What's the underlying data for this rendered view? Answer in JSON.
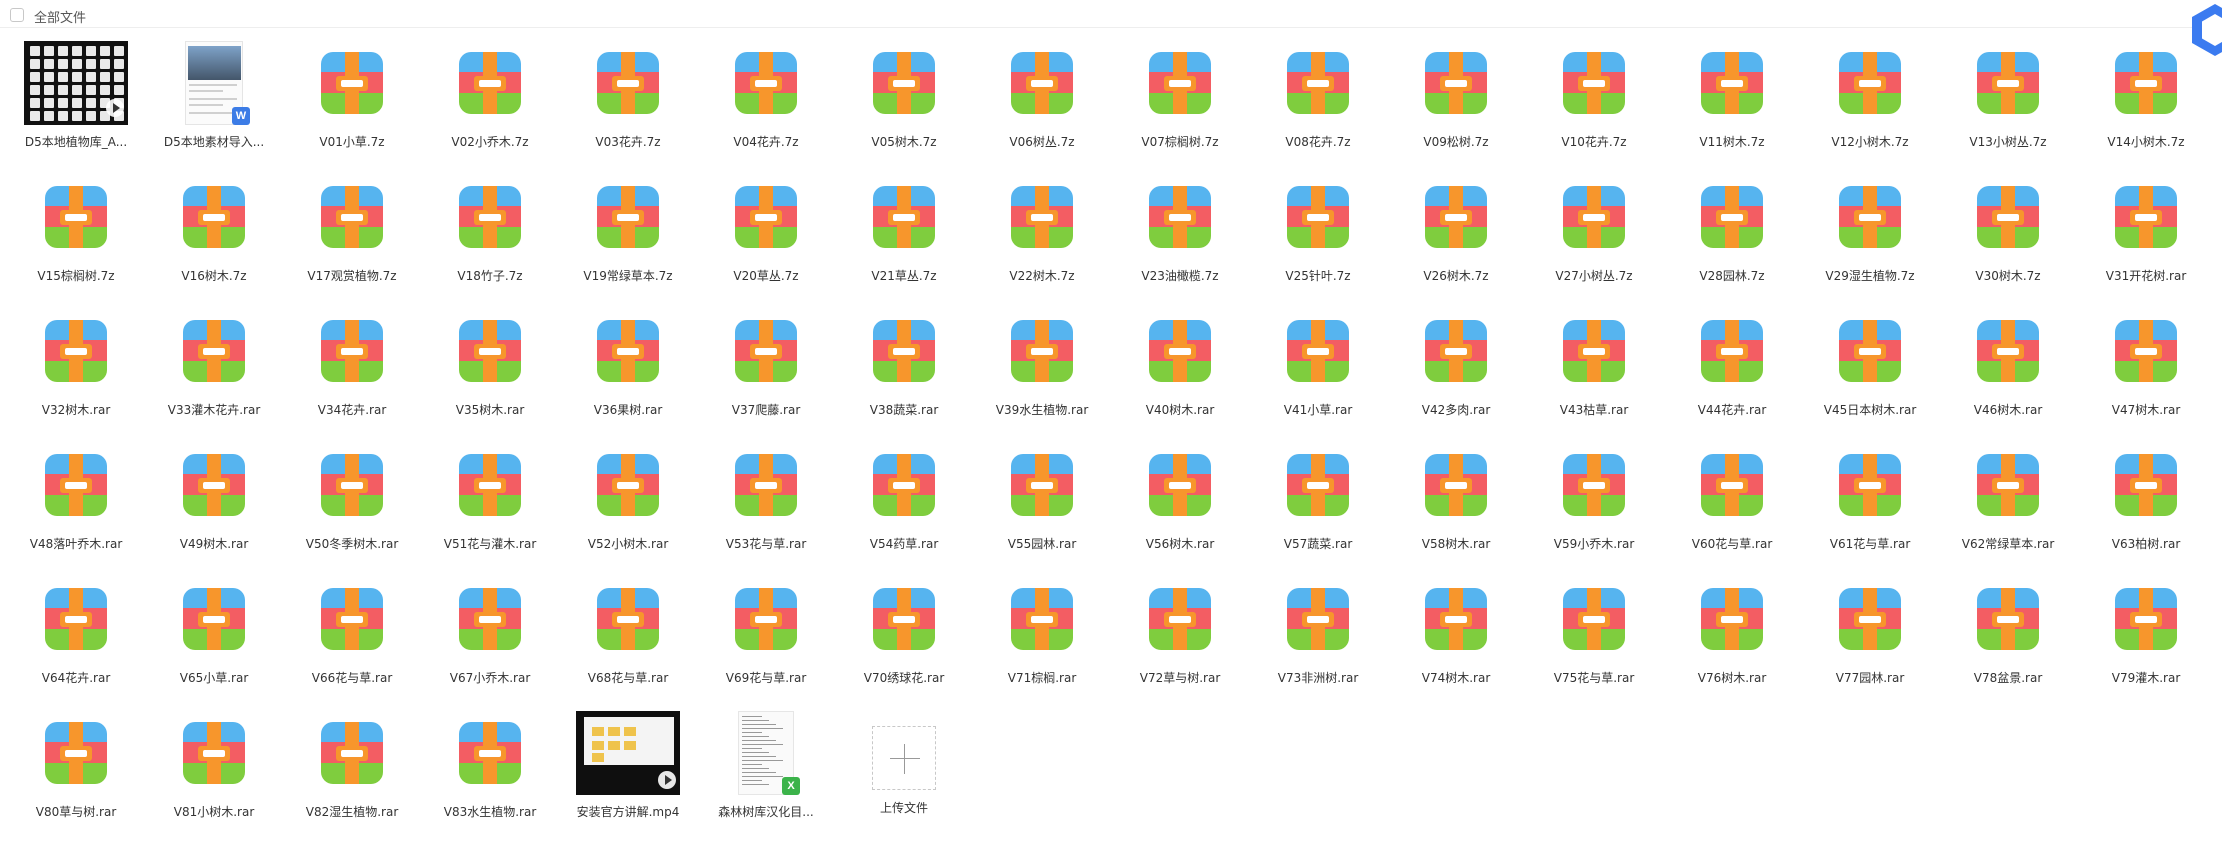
{
  "header": {
    "title": "全部文件"
  },
  "colors": {
    "archive_top": "#56b4ef",
    "archive_mid": "#f35d63",
    "archive_bottom": "#7fcd3e",
    "archive_strap": "#f7962c",
    "corner_badge": "#3b7bf0"
  },
  "files": [
    {
      "name": "D5本地植物库_A...",
      "kind": "image-grid"
    },
    {
      "name": "D5本地素材导入...",
      "kind": "word-doc"
    },
    {
      "name": "V01小草.7z",
      "kind": "archive"
    },
    {
      "name": "V02小乔木.7z",
      "kind": "archive"
    },
    {
      "name": "V03花卉.7z",
      "kind": "archive"
    },
    {
      "name": "V04花卉.7z",
      "kind": "archive"
    },
    {
      "name": "V05树木.7z",
      "kind": "archive"
    },
    {
      "name": "V06树丛.7z",
      "kind": "archive"
    },
    {
      "name": "V07棕榈树.7z",
      "kind": "archive"
    },
    {
      "name": "V08花卉.7z",
      "kind": "archive"
    },
    {
      "name": "V09松树.7z",
      "kind": "archive"
    },
    {
      "name": "V10花卉.7z",
      "kind": "archive"
    },
    {
      "name": "V11树木.7z",
      "kind": "archive"
    },
    {
      "name": "V12小树木.7z",
      "kind": "archive"
    },
    {
      "name": "V13小树丛.7z",
      "kind": "archive"
    },
    {
      "name": "V14小树木.7z",
      "kind": "archive"
    },
    {
      "name": "V15棕榈树.7z",
      "kind": "archive"
    },
    {
      "name": "V16树木.7z",
      "kind": "archive"
    },
    {
      "name": "V17观赏植物.7z",
      "kind": "archive"
    },
    {
      "name": "V18竹子.7z",
      "kind": "archive"
    },
    {
      "name": "V19常绿草本.7z",
      "kind": "archive"
    },
    {
      "name": "V20草丛.7z",
      "kind": "archive"
    },
    {
      "name": "V21草丛.7z",
      "kind": "archive"
    },
    {
      "name": "V22树木.7z",
      "kind": "archive"
    },
    {
      "name": "V23油橄榄.7z",
      "kind": "archive"
    },
    {
      "name": "V25针叶.7z",
      "kind": "archive"
    },
    {
      "name": "V26树木.7z",
      "kind": "archive"
    },
    {
      "name": "V27小树丛.7z",
      "kind": "archive"
    },
    {
      "name": "V28园林.7z",
      "kind": "archive"
    },
    {
      "name": "V29湿生植物.7z",
      "kind": "archive"
    },
    {
      "name": "V30树木.7z",
      "kind": "archive"
    },
    {
      "name": "V31开花树.rar",
      "kind": "archive"
    },
    {
      "name": "V32树木.rar",
      "kind": "archive"
    },
    {
      "name": "V33灌木花卉.rar",
      "kind": "archive"
    },
    {
      "name": "V34花卉.rar",
      "kind": "archive"
    },
    {
      "name": "V35树木.rar",
      "kind": "archive"
    },
    {
      "name": "V36果树.rar",
      "kind": "archive"
    },
    {
      "name": "V37爬藤.rar",
      "kind": "archive"
    },
    {
      "name": "V38蔬菜.rar",
      "kind": "archive"
    },
    {
      "name": "V39水生植物.rar",
      "kind": "archive"
    },
    {
      "name": "V40树木.rar",
      "kind": "archive"
    },
    {
      "name": "V41小草.rar",
      "kind": "archive"
    },
    {
      "name": "V42多肉.rar",
      "kind": "archive"
    },
    {
      "name": "V43枯草.rar",
      "kind": "archive"
    },
    {
      "name": "V44花卉.rar",
      "kind": "archive"
    },
    {
      "name": "V45日本树木.rar",
      "kind": "archive"
    },
    {
      "name": "V46树木.rar",
      "kind": "archive"
    },
    {
      "name": "V47树木.rar",
      "kind": "archive"
    },
    {
      "name": "V48落叶乔木.rar",
      "kind": "archive"
    },
    {
      "name": "V49树木.rar",
      "kind": "archive"
    },
    {
      "name": "V50冬季树木.rar",
      "kind": "archive"
    },
    {
      "name": "V51花与灌木.rar",
      "kind": "archive"
    },
    {
      "name": "V52小树木.rar",
      "kind": "archive"
    },
    {
      "name": "V53花与草.rar",
      "kind": "archive"
    },
    {
      "name": "V54药草.rar",
      "kind": "archive"
    },
    {
      "name": "V55园林.rar",
      "kind": "archive"
    },
    {
      "name": "V56树木.rar",
      "kind": "archive"
    },
    {
      "name": "V57蔬菜.rar",
      "kind": "archive"
    },
    {
      "name": "V58树木.rar",
      "kind": "archive"
    },
    {
      "name": "V59小乔木.rar",
      "kind": "archive"
    },
    {
      "name": "V60花与草.rar",
      "kind": "archive"
    },
    {
      "name": "V61花与草.rar",
      "kind": "archive"
    },
    {
      "name": "V62常绿草本.rar",
      "kind": "archive"
    },
    {
      "name": "V63柏树.rar",
      "kind": "archive"
    },
    {
      "name": "V64花卉.rar",
      "kind": "archive"
    },
    {
      "name": "V65小草.rar",
      "kind": "archive"
    },
    {
      "name": "V66花与草.rar",
      "kind": "archive"
    },
    {
      "name": "V67小乔木.rar",
      "kind": "archive"
    },
    {
      "name": "V68花与草.rar",
      "kind": "archive"
    },
    {
      "name": "V69花与草.rar",
      "kind": "archive"
    },
    {
      "name": "V70绣球花.rar",
      "kind": "archive"
    },
    {
      "name": "V71棕榈.rar",
      "kind": "archive"
    },
    {
      "name": "V72草与树.rar",
      "kind": "archive"
    },
    {
      "name": "V73非洲树.rar",
      "kind": "archive"
    },
    {
      "name": "V74树木.rar",
      "kind": "archive"
    },
    {
      "name": "V75花与草.rar",
      "kind": "archive"
    },
    {
      "name": "V76树木.rar",
      "kind": "archive"
    },
    {
      "name": "V77园林.rar",
      "kind": "archive"
    },
    {
      "name": "V78盆景.rar",
      "kind": "archive"
    },
    {
      "name": "V79灌木.rar",
      "kind": "archive"
    },
    {
      "name": "V80草与树.rar",
      "kind": "archive"
    },
    {
      "name": "V81小树木.rar",
      "kind": "archive"
    },
    {
      "name": "V82湿生植物.rar",
      "kind": "archive"
    },
    {
      "name": "V83水生植物.rar",
      "kind": "archive"
    },
    {
      "name": "安装官方讲解.mp4",
      "kind": "video"
    },
    {
      "name": "森林树库汉化目...",
      "kind": "excel"
    },
    {
      "name": "上传文件",
      "kind": "upload"
    }
  ]
}
